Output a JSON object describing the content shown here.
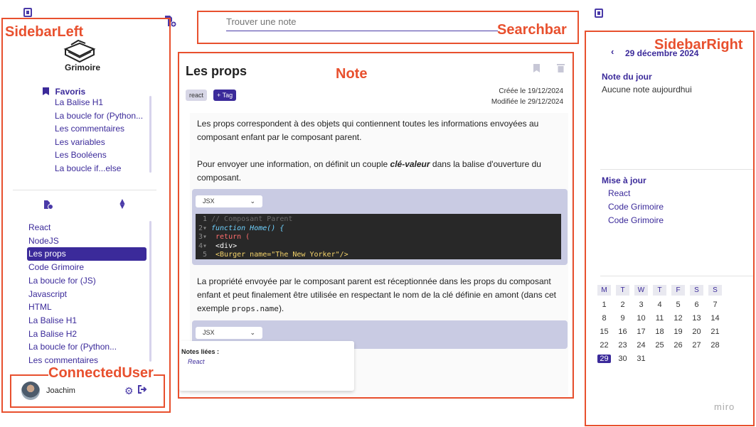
{
  "annotations": {
    "sidebar_left": "SidebarLeft",
    "searchbar": "Searchbar",
    "note": "Note",
    "sidebar_right": "SidebarRight",
    "connected_user": "ConnectedUser"
  },
  "search": {
    "placeholder": "Trouver une note"
  },
  "sidebar_left": {
    "app_name": "Grimoire",
    "favorites_title": "Favoris",
    "favorites": [
      "La Balise H1",
      "La boucle for (Python...",
      "Les commentaires",
      "Les variables",
      "Les Booléens",
      "La boucle if...else"
    ],
    "notes": [
      "React",
      "NodeJS",
      "Les props",
      "Code Grimoire",
      "La boucle for (JS)",
      "Javascript",
      "HTML",
      "La Balise H1",
      "La Balise H2",
      "La boucle for (Python...",
      "Les commentaires"
    ],
    "active_note_index": 2
  },
  "user": {
    "name": "Joachim"
  },
  "note": {
    "title": "Les props",
    "tags": [
      "react"
    ],
    "add_tag_label": "+ Tag",
    "created": "Créée le 19/12/2024",
    "modified": "Modifiée le 29/12/2024",
    "para1": "Les props correspondent à des objets qui contiennent toutes les informations envoyées au composant enfant par le composant parent.",
    "para2_before": "Pour envoyer une information, on définit un couple ",
    "para2_emph": "clé-valeur",
    "para2_after": " dans la balise d'ouverture du composant.",
    "code_lang": "JSX",
    "code_lines": [
      {
        "n": "1",
        "text": "// Composant Parent"
      },
      {
        "n": "2",
        "text": "function Home() {"
      },
      {
        "n": "3",
        "text": "  return ("
      },
      {
        "n": "4",
        "text": "    <div>"
      },
      {
        "n": "5",
        "text": "      <Burger name=\"The New Yorker\"/>"
      }
    ],
    "para3_before": "La propriété envoyée par le composant parent est réceptionnée dans les props du composant enfant et peut finalement être utilisée en respectant le nom de la clé définie en amont (dans cet exemple ",
    "para3_code": "props.name",
    "para3_after": ").",
    "code_lang_2": "JSX",
    "linked_title": "Notes liées :",
    "linked": [
      "React"
    ]
  },
  "sidebar_right": {
    "date_label": "29 décembre 2024",
    "note_du_jour_title": "Note du jour",
    "note_du_jour_text": "Aucune note aujourdhui",
    "updates_title": "Mise à jour",
    "updates": [
      "React",
      "Code Grimoire",
      "Code Grimoire"
    ],
    "calendar_headers": [
      "M",
      "T",
      "W",
      "T",
      "F",
      "S",
      "S"
    ],
    "calendar_rows": [
      [
        "1",
        "2",
        "3",
        "4",
        "5",
        "6",
        "7"
      ],
      [
        "8",
        "9",
        "10",
        "11",
        "12",
        "13",
        "14"
      ],
      [
        "15",
        "16",
        "17",
        "18",
        "19",
        "20",
        "21"
      ],
      [
        "22",
        "23",
        "24",
        "25",
        "26",
        "27",
        "28"
      ],
      [
        "29",
        "30",
        "31",
        "",
        "",
        "",
        ""
      ]
    ],
    "today": "29"
  },
  "watermark": "miro"
}
